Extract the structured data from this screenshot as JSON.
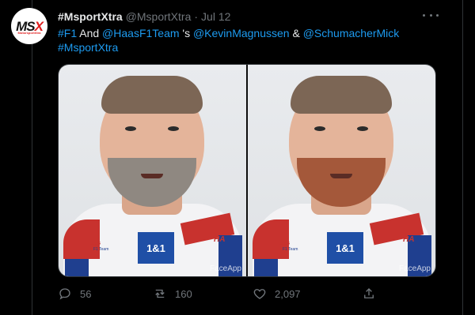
{
  "account": {
    "avatar_logo_left": "MS",
    "avatar_logo_right": "X",
    "avatar_logo_sub": "MotorsportXtra",
    "display_name": "#MsportXtra",
    "handle": "@MsportXtra",
    "separator": "·",
    "timestamp": "Jul 12"
  },
  "tweet": {
    "text_parts": [
      {
        "text": "#F1",
        "link": true
      },
      {
        "text": " And ",
        "link": false
      },
      {
        "text": "@HaasF1Team",
        "link": true
      },
      {
        "text": " 's ",
        "link": false
      },
      {
        "text": "@KevinMagnussen",
        "link": true
      },
      {
        "text": " & ",
        "link": false
      },
      {
        "text": "@SchumacherMick",
        "link": true
      },
      {
        "text": "#MsportXtra",
        "link": true
      }
    ]
  },
  "media": {
    "photos": [
      {
        "name": "left-photo",
        "beard": "grey",
        "badge": "1&1",
        "team": "Haas",
        "team_sub": "F1 Team",
        "sleeve": "HA",
        "watermark": "FaceApp"
      },
      {
        "name": "right-photo",
        "beard": "ginger",
        "badge": "1&1",
        "team": "Haas",
        "team_sub": "F1 Team",
        "sleeve": "HA",
        "watermark": "FaceApp"
      }
    ]
  },
  "actions": {
    "reply_count": "56",
    "retweet_count": "160",
    "like_count": "2,097",
    "share_count": ""
  },
  "colors": {
    "background": "#000000",
    "link": "#1d9bf0",
    "muted": "#71767b",
    "text": "#e7e9ea"
  }
}
